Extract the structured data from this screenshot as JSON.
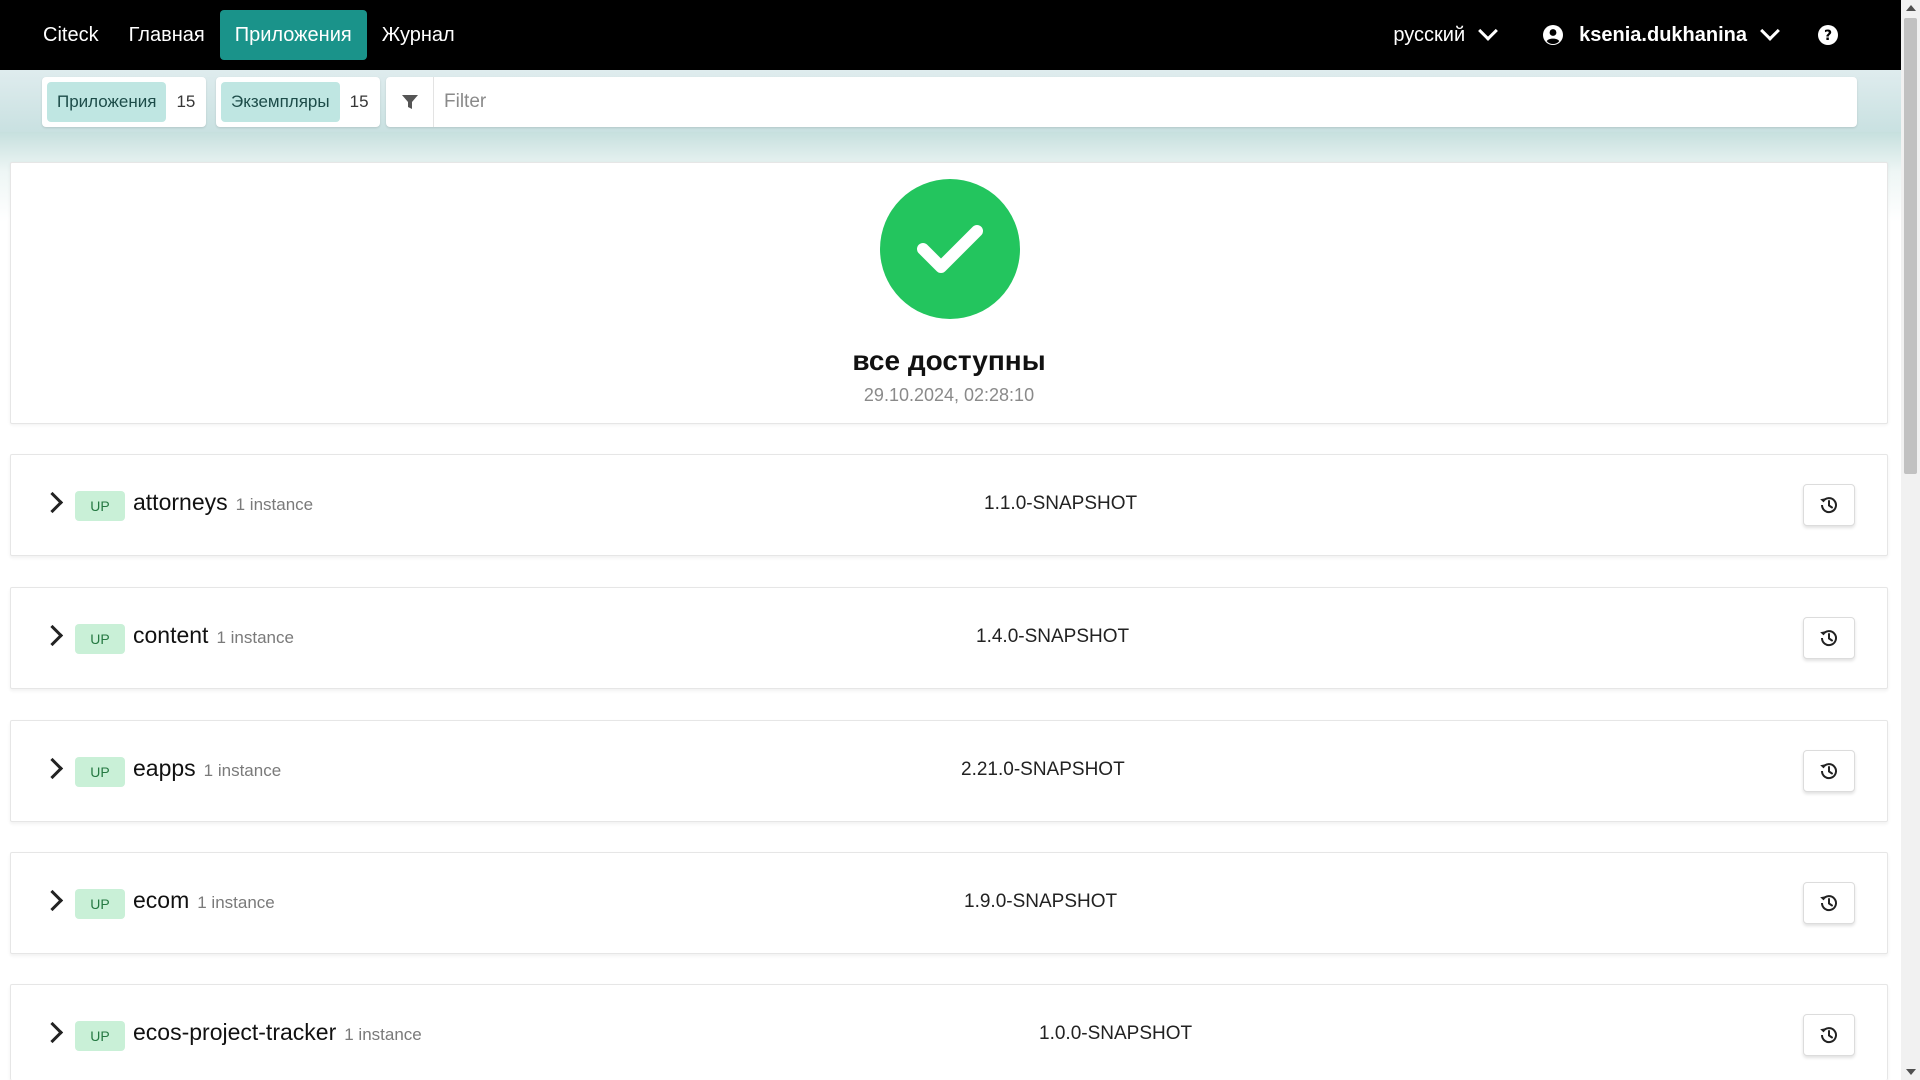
{
  "navbar": {
    "items": [
      {
        "label": "Citeck",
        "active": false
      },
      {
        "label": "Главная",
        "active": false
      },
      {
        "label": "Приложения",
        "active": true
      },
      {
        "label": "Журнал",
        "active": false
      }
    ],
    "language": "русский",
    "username": "ksenia.dukhanina",
    "icons": {
      "user": "user-circle-icon",
      "help": "question-circle-icon",
      "dropdown": "chevron-down-icon"
    }
  },
  "filterbar": {
    "apps_label": "Приложения",
    "apps_count": "15",
    "instances_label": "Экземпляры",
    "instances_count": "15",
    "filter_placeholder": "Filter",
    "filter_icon": "funnel-icon"
  },
  "status": {
    "title": "все доступны",
    "timestamp": "29.10.2024, 02:28:10",
    "icon": "check-circle-icon",
    "color": "#23c55e"
  },
  "applications": [
    {
      "status": "UP",
      "name": "attorneys",
      "instances": "1 instance",
      "version": "1.1.0-SNAPSHOT"
    },
    {
      "status": "UP",
      "name": "content",
      "instances": "1 instance",
      "version": "1.4.0-SNAPSHOT"
    },
    {
      "status": "UP",
      "name": "eapps",
      "instances": "1 instance",
      "version": "2.21.0-SNAPSHOT"
    },
    {
      "status": "UP",
      "name": "ecom",
      "instances": "1 instance",
      "version": "1.9.0-SNAPSHOT"
    },
    {
      "status": "UP",
      "name": "ecos-project-tracker",
      "instances": "1 instance",
      "version": "1.0.0-SNAPSHOT"
    }
  ],
  "colors": {
    "accent": "#1a938a",
    "navbar": "#000000",
    "up_badge_bg": "#c9f0d7",
    "up_badge_text": "#257942"
  }
}
